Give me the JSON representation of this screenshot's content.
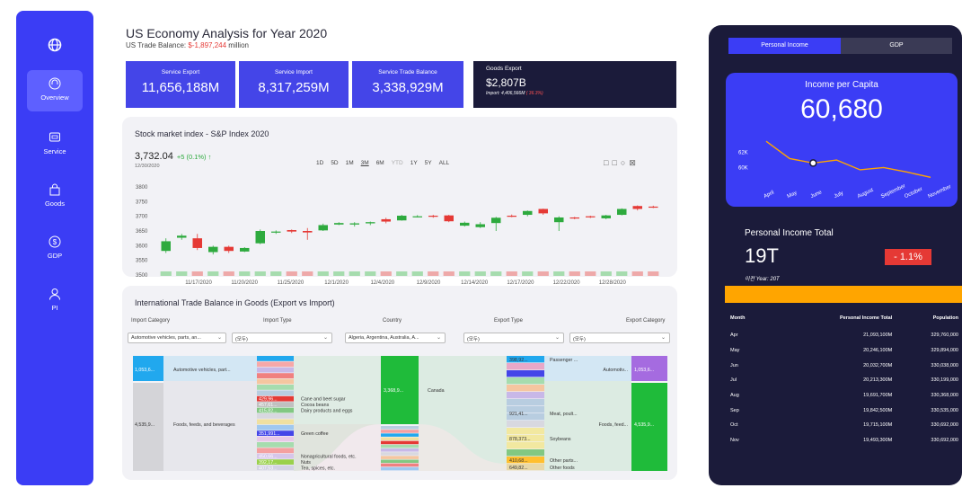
{
  "sidebar": {
    "logo_icon": "globe-icon",
    "items": [
      {
        "label": "Overview",
        "icon": "headset-icon",
        "active": true
      },
      {
        "label": "Service",
        "icon": "service-icon",
        "active": false
      },
      {
        "label": "Goods",
        "icon": "bag-icon",
        "active": false
      },
      {
        "label": "GDP",
        "icon": "dollar-icon",
        "active": false
      },
      {
        "label": "PI",
        "icon": "person-icon",
        "active": false
      }
    ]
  },
  "header": {
    "title": "US Economy Analysis for Year 2020",
    "subtitle_label": "US Trade Balance: ",
    "subtitle_value": "$-1,897,244",
    "subtitle_unit": " million"
  },
  "kpis": [
    {
      "label": "Service Export",
      "value": "11,656,188M"
    },
    {
      "label": "Service Import",
      "value": "8,317,259M"
    },
    {
      "label": "Service Trade Balance",
      "value": "3,338,929M"
    }
  ],
  "goods_export": {
    "label": "Goods Export",
    "value": "$2,807B",
    "import_text": "Import: 4,406,566M",
    "change": "( 36.3%)"
  },
  "stock": {
    "title": "Stock market index - S&P Index 2020",
    "price": "3,732.04",
    "change": "+5 (0.1%) ↑",
    "date": "12/30/2020",
    "ranges": [
      "1D",
      "5D",
      "1M",
      "3M",
      "6M",
      "YTD",
      "1Y",
      "5Y",
      "ALL"
    ],
    "active_range": "3M",
    "colors": {
      "up": "#2eaa3e",
      "down": "#e53935",
      "volume_up": "#a6dcae",
      "volume_down": "#eea9a9"
    }
  },
  "chart_data": {
    "type": "candlestick",
    "title": "Stock market index - S&P Index 2020",
    "ylim": [
      3500,
      3800
    ],
    "y_ticks": [
      3500,
      3550,
      3600,
      3650,
      3700,
      3750,
      3800
    ],
    "x_tick_labels": [
      "11/17/2020",
      "11/20/2020",
      "11/25/2020",
      "12/1/2020",
      "12/4/2020",
      "12/9/2020",
      "12/14/2020",
      "12/17/2020",
      "12/22/2020",
      "12/28/2020"
    ],
    "candles": [
      {
        "o": 3582,
        "c": 3615,
        "h": 3625,
        "l": 3575
      },
      {
        "o": 3627,
        "c": 3634,
        "h": 3640,
        "l": 3620
      },
      {
        "o": 3625,
        "c": 3592,
        "h": 3640,
        "l": 3585
      },
      {
        "o": 3578,
        "c": 3596,
        "h": 3600,
        "l": 3570
      },
      {
        "o": 3596,
        "c": 3582,
        "h": 3600,
        "l": 3575
      },
      {
        "o": 3580,
        "c": 3592,
        "h": 3595,
        "l": 3578
      },
      {
        "o": 3608,
        "c": 3650,
        "h": 3655,
        "l": 3605
      },
      {
        "o": 3645,
        "c": 3648,
        "h": 3652,
        "l": 3640
      },
      {
        "o": 3653,
        "c": 3648,
        "h": 3655,
        "l": 3643
      },
      {
        "o": 3650,
        "c": 3645,
        "h": 3660,
        "l": 3620
      },
      {
        "o": 3652,
        "c": 3670,
        "h": 3675,
        "l": 3650
      },
      {
        "o": 3672,
        "c": 3677,
        "h": 3680,
        "l": 3670
      },
      {
        "o": 3672,
        "c": 3676,
        "h": 3680,
        "l": 3665
      },
      {
        "o": 3676,
        "c": 3680,
        "h": 3682,
        "l": 3670
      },
      {
        "o": 3690,
        "c": 3682,
        "h": 3695,
        "l": 3676
      },
      {
        "o": 3686,
        "c": 3702,
        "h": 3705,
        "l": 3685
      },
      {
        "o": 3699,
        "c": 3700,
        "h": 3704,
        "l": 3696
      },
      {
        "o": 3702,
        "c": 3701,
        "h": 3705,
        "l": 3695
      },
      {
        "o": 3703,
        "c": 3683,
        "h": 3705,
        "l": 3680
      },
      {
        "o": 3668,
        "c": 3678,
        "h": 3682,
        "l": 3665
      },
      {
        "o": 3663,
        "c": 3673,
        "h": 3680,
        "l": 3660
      },
      {
        "o": 3677,
        "c": 3695,
        "h": 3698,
        "l": 3650
      },
      {
        "o": 3702,
        "c": 3701,
        "h": 3706,
        "l": 3697
      },
      {
        "o": 3705,
        "c": 3718,
        "h": 3720,
        "l": 3700
      },
      {
        "o": 3725,
        "c": 3710,
        "h": 3726,
        "l": 3705
      },
      {
        "o": 3680,
        "c": 3696,
        "h": 3700,
        "l": 3650
      },
      {
        "o": 3696,
        "c": 3694,
        "h": 3698,
        "l": 3690
      },
      {
        "o": 3700,
        "c": 3698,
        "h": 3702,
        "l": 3694
      },
      {
        "o": 3693,
        "c": 3703,
        "h": 3705,
        "l": 3690
      },
      {
        "o": 3705,
        "c": 3725,
        "h": 3727,
        "l": 3703
      },
      {
        "o": 3735,
        "c": 3725,
        "h": 3737,
        "l": 3720
      },
      {
        "o": 3733,
        "c": 3732,
        "h": 3736,
        "l": 3728
      }
    ]
  },
  "trade": {
    "title": "International Trade Balance in Goods (Export vs Import)",
    "columns": [
      "Import Category",
      "Import Type",
      "Country",
      "Export Type",
      "Export Category"
    ],
    "filters": [
      "Automotive vehicles, parts, an...",
      "(모두)",
      "Algeria, Argentina, Australia, A...",
      "(모두)",
      "(모두)"
    ],
    "import_category_nodes": [
      {
        "value": "1,053,6...",
        "label": "Automotive vehicles, part...",
        "color": "#21a8ee"
      },
      {
        "value": "4,535,9...",
        "label": "Foods, feeds, and beverages",
        "color": "#d4d4d8"
      }
    ],
    "import_type_labels": [
      {
        "value": "429,96...",
        "label": "Cane and beet sugar",
        "color": "#e53935"
      },
      {
        "value": "457,61...",
        "label": "Cocoa beans",
        "color": "#b0b0b0"
      },
      {
        "value": "415,82...",
        "label": "Dairy products and eggs",
        "color": "#82c882"
      },
      {
        "value": "351,991...",
        "label": "Green coffee",
        "color": "#4445e8"
      },
      {
        "value": "450,66...",
        "label": "Nonagricultural foods, etc.",
        "color": "#d7c6ea"
      },
      {
        "value": "392,17...",
        "label": "Nuts",
        "color": "#9ad14b"
      },
      {
        "value": "407,53...",
        "label": "Tea, spices, etc.",
        "color": "#d3d3e3"
      }
    ],
    "country_node": {
      "value": "3,368,9...",
      "label": "Canada",
      "color": "#1fbb3a"
    },
    "export_type_labels": [
      {
        "value": "398,92...",
        "label": "Passenger ...",
        "color": "#21a8ee"
      },
      {
        "value": "921,41...",
        "label": "Meat, poult...",
        "color": "#b8cde0"
      },
      {
        "value": "878,373...",
        "label": "Soybeans",
        "color": "#f2e8a0"
      },
      {
        "value": "410,68...",
        "label": "Other parts...",
        "color": "#ffbf2f"
      },
      {
        "value": "649,82...",
        "label": "Other foods",
        "color": "#e8d8a8"
      }
    ],
    "export_category_nodes": [
      {
        "value": "1,053,6...",
        "label": "Automotiv...",
        "color": "#a56be0"
      },
      {
        "value": "4,535,9...",
        "label": "Foods, feed...",
        "color": "#1fbb3a"
      }
    ]
  },
  "right_panel": {
    "tabs": [
      "Personal Income",
      "GDP"
    ],
    "active_tab": "Personal Income",
    "ipc_title": "Income per Capita",
    "ipc_value": "60,680",
    "ipc_chart": {
      "type": "line",
      "categories": [
        "April",
        "May",
        "June",
        "July",
        "August",
        "September",
        "October",
        "November"
      ],
      "values": [
        63500,
        61200,
        60600,
        61000,
        59700,
        60000,
        59400,
        58700
      ],
      "y_tick_labels": [
        "62K",
        "60K"
      ],
      "highlight": "June",
      "line_color": "#ffa500"
    },
    "pit_title": "Personal Income Total",
    "pit_value": "19T",
    "pit_change": "- 1.1%",
    "pit_prev": "이전 Year: 20T",
    "table_headers": [
      "Month",
      "Personal Income Total",
      "Population"
    ],
    "table_rows": [
      [
        "Apr",
        "21,093,100M",
        "329,760,000"
      ],
      [
        "May",
        "20,246,100M",
        "329,894,000"
      ],
      [
        "Jun",
        "20,032,700M",
        "330,038,000"
      ],
      [
        "Jul",
        "20,213,300M",
        "330,199,000"
      ],
      [
        "Aug",
        "19,691,700M",
        "330,368,000"
      ],
      [
        "Sep",
        "19,842,500M",
        "330,535,000"
      ],
      [
        "Oct",
        "19,715,100M",
        "330,692,000"
      ],
      [
        "Nov",
        "19,493,300M",
        "330,692,000"
      ]
    ]
  }
}
